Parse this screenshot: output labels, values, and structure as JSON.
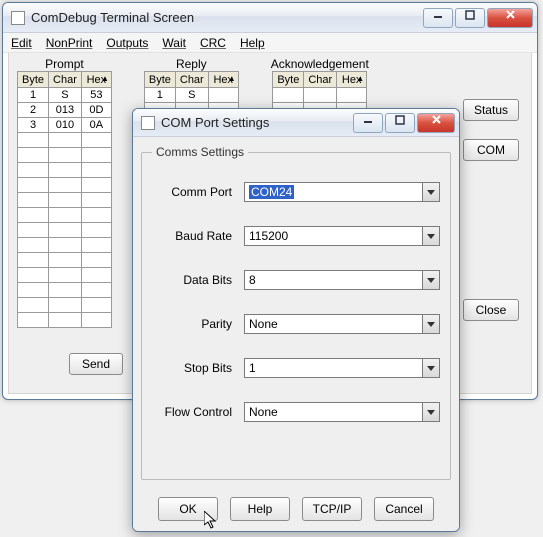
{
  "main": {
    "title": "ComDebug Terminal Screen",
    "menu": [
      "Edit",
      "NonPrint",
      "Outputs",
      "Wait",
      "CRC",
      "Help"
    ],
    "sections": {
      "prompt": "Prompt",
      "reply": "Reply",
      "ack": "Acknowledgement"
    },
    "headers": {
      "byte": "Byte",
      "char": "Char",
      "hex": "Hex"
    },
    "prompt_rows": [
      {
        "byte": "1",
        "char": "S",
        "hex": "53"
      },
      {
        "byte": "2",
        "char": "013",
        "hex": "0D"
      },
      {
        "byte": "3",
        "char": "010",
        "hex": "0A"
      }
    ],
    "reply_rows": [
      {
        "byte": "1",
        "char": "S",
        "hex": ""
      }
    ],
    "ack_rows": [],
    "buttons": {
      "status": "Status",
      "com": "COM",
      "close": "Close",
      "send": "Send"
    }
  },
  "dialog": {
    "title": "COM Port Settings",
    "legend": "Comms Settings",
    "fields": {
      "comm_port": {
        "label": "Comm Port",
        "value": "COM24"
      },
      "baud": {
        "label": "Baud Rate",
        "value": "115200"
      },
      "data_bits": {
        "label": "Data Bits",
        "value": "8"
      },
      "parity": {
        "label": "Parity",
        "value": "None"
      },
      "stop_bits": {
        "label": "Stop Bits",
        "value": "1"
      },
      "flow": {
        "label": "Flow Control",
        "value": "None"
      }
    },
    "buttons": {
      "ok": "OK",
      "help": "Help",
      "tcpip": "TCP/IP",
      "cancel": "Cancel"
    }
  }
}
